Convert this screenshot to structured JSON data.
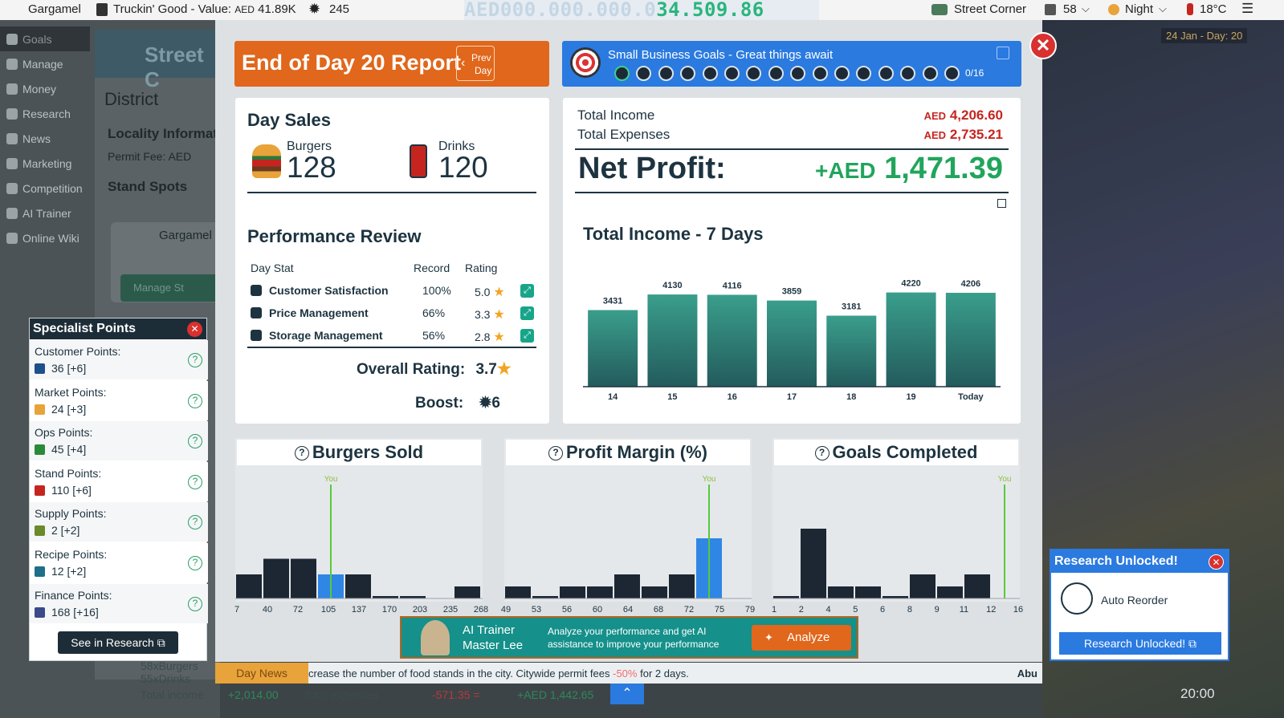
{
  "topbar": {
    "player": "Gargamel",
    "business": "Truckin' Good - Value:",
    "business_currency": "AED",
    "business_value": "41.89K",
    "reputation": "245",
    "money_ghost": "AED000.000.000.0",
    "money_value": "34.509.86",
    "location": "Street Corner",
    "weather_value": "58",
    "time_of_day": "Night",
    "temperature": "18°C"
  },
  "left_nav": {
    "items": [
      "Goals",
      "Manage",
      "Money",
      "Research",
      "News",
      "Marketing",
      "Competition",
      "AI Trainer",
      "Online Wiki"
    ]
  },
  "bg_panel": {
    "header": "Street C",
    "district": "District",
    "locality": "Locality Informat",
    "permit": "Permit Fee: AED",
    "stand_spots": "Stand Spots",
    "stand_owner": "Gargamel",
    "manage_button": "Manage St"
  },
  "right_bg": {
    "date": "24 Jan - Day: 20",
    "time": "20:00"
  },
  "report": {
    "title": "End of Day 20 Report",
    "prev_day_1": "Prev",
    "prev_day_2": "Day",
    "close": "✕"
  },
  "goals": {
    "title": "Small Business Goals - Great things await",
    "count": "0/16"
  },
  "day_sales": {
    "title": "Day Sales",
    "burgers_label": "Burgers",
    "burgers_value": "128",
    "drinks_label": "Drinks",
    "drinks_value": "120"
  },
  "performance": {
    "title": "Performance Review",
    "col_stat": "Day Stat",
    "col_record": "Record",
    "col_rating": "Rating",
    "rows": [
      {
        "name": "Customer Satisfaction",
        "record": "100%",
        "rating": "5.0"
      },
      {
        "name": "Price Management",
        "record": "66%",
        "rating": "3.3"
      },
      {
        "name": "Storage Management",
        "record": "56%",
        "rating": "2.8"
      }
    ],
    "overall_label": "Overall Rating:",
    "overall_value": "3.7",
    "boost_label": "Boost:",
    "boost_value": "6"
  },
  "income": {
    "total_income_label": "Total Income",
    "total_income_currency": "AED",
    "total_income_value": "4,206.60",
    "total_expenses_label": "Total Expenses",
    "total_expenses_currency": "AED",
    "total_expenses_value": "2,735.21",
    "net_profit_label": "Net Profit:",
    "net_profit_prefix": "+AED",
    "net_profit_value": "1,471.39",
    "colors": {
      "expense": "#c6251f",
      "profit": "#21a55c"
    }
  },
  "chart_data": [
    {
      "type": "bar",
      "title": "Total Income - 7 Days",
      "categories": [
        "14",
        "15",
        "16",
        "17",
        "18",
        "19",
        "Today"
      ],
      "values": [
        3431,
        4130,
        4116,
        3859,
        3181,
        4220,
        4206
      ],
      "ylim": [
        0,
        4600
      ],
      "color": "#2e8f80",
      "grid": false
    },
    {
      "type": "bar",
      "title": "Burgers Sold",
      "x_ticks": [
        "7",
        "40",
        "72",
        "105",
        "137",
        "170",
        "203",
        "235",
        "268"
      ],
      "values": [
        0.2,
        0.33,
        0.33,
        0.2,
        0.2,
        0.02,
        0.02,
        0,
        0.1
      ],
      "highlight_index": 3,
      "you_label": "You",
      "you_position": 3.5
    },
    {
      "type": "bar",
      "title": "Profit Margin (%)",
      "x_ticks": [
        "49",
        "53",
        "56",
        "60",
        "64",
        "68",
        "72",
        "75",
        "79"
      ],
      "values": [
        0.1,
        0.02,
        0.1,
        0.1,
        0.2,
        0.1,
        0.2,
        0.5,
        0
      ],
      "highlight_index": 7,
      "you_label": "You",
      "you_position": 7.5
    },
    {
      "type": "bar",
      "title": "Goals Completed",
      "x_ticks": [
        "1",
        "2",
        "4",
        "5",
        "6",
        "8",
        "9",
        "11",
        "12",
        "16"
      ],
      "values": [
        0.02,
        0.58,
        0.1,
        0.1,
        0.02,
        0.2,
        0.1,
        0.2,
        0
      ],
      "highlight_index": -1,
      "you_label": "You",
      "you_position": 8.5
    }
  ],
  "ai_trainer": {
    "name_1": "AI Trainer",
    "name_2": "Master Lee",
    "description": "Analyze your performance and get AI assistance to improve your performance",
    "button": "Analyze"
  },
  "news": {
    "tag": "Day News",
    "text_before": "crease the number of food stands in the city. Citywide permit fees",
    "pct": "-50%",
    "text_after": "for 2 days.",
    "more": "Abu"
  },
  "bottom_stats": {
    "burgers": "58xBurgers",
    "drinks": "55xDrinks",
    "total_income_label": "Total income",
    "total_income_value": "+2,014.00",
    "total_expenses_label": "Total expenses",
    "total_expenses_value": "-571.35 =",
    "net": "+AED 1,442.65"
  },
  "specialist": {
    "title": "Specialist Points",
    "rows": [
      {
        "label": "Customer Points:",
        "value": "36 [+6]"
      },
      {
        "label": "Market Points:",
        "value": "24 [+3]"
      },
      {
        "label": "Ops Points:",
        "value": "45 [+4]"
      },
      {
        "label": "Stand Points:",
        "value": "110 [+6]"
      },
      {
        "label": "Supply Points:",
        "value": "2 [+2]"
      },
      {
        "label": "Recipe Points:",
        "value": "12 [+2]"
      },
      {
        "label": "Finance Points:",
        "value": "168 [+16]"
      }
    ],
    "button": "See in Research"
  },
  "research": {
    "title": "Research Unlocked!",
    "item": "Auto Reorder",
    "button": "Research Unlocked!"
  }
}
